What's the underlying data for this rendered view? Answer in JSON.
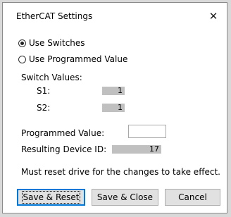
{
  "window": {
    "title": "EtherCAT Settings",
    "close_glyph": "✕"
  },
  "mode": {
    "option_switches": "Use Switches",
    "option_programmed": "Use Programmed Value",
    "selected": "switches"
  },
  "switches": {
    "heading": "Switch Values:",
    "s1_label": "S1:",
    "s1_value": "1",
    "s2_label": "S2:",
    "s2_value": "1"
  },
  "programmed": {
    "label": "Programmed Value:",
    "value": ""
  },
  "result": {
    "label": "Resulting Device ID:",
    "value": "17"
  },
  "notice": "Must reset drive for the changes to take effect.",
  "buttons": {
    "save_reset": "Save & Reset",
    "save_close": "Save & Close",
    "cancel": "Cancel"
  }
}
